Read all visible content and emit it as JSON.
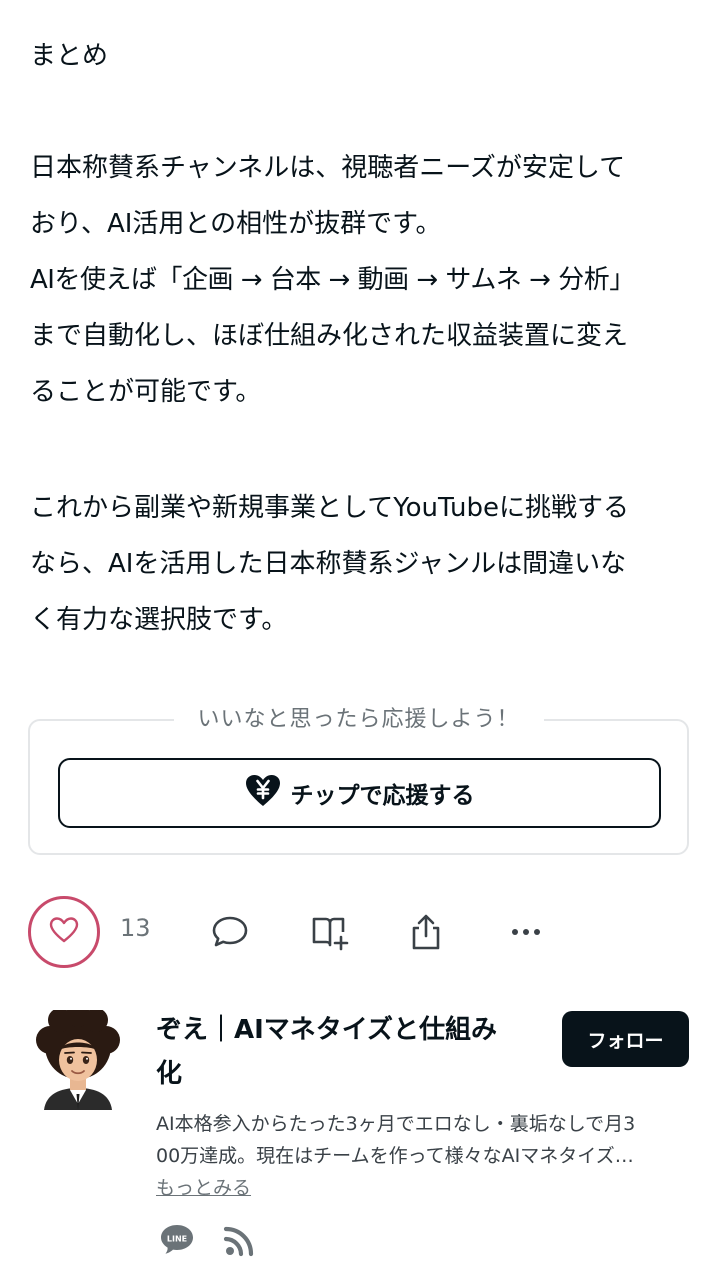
{
  "article": {
    "heading": "まとめ",
    "paragraph1_lines": [
      "日本称賛系チャンネルは、視聴者ニーズが安定して",
      "おり、AI活用との相性が抜群です。",
      "AIを使えば「企画 → 台本 → 動画 → サムネ → 分析」",
      "まで自動化し、ほぼ仕組み化された収益装置に変え",
      "ることが可能です。"
    ],
    "paragraph2_lines": [
      "これから副業や新規事業としてYouTubeに挑戦する",
      "なら、AIを活用した日本称賛系ジャンルは間違いな",
      "く有力な選択肢です。"
    ]
  },
  "support": {
    "caption": "いいなと思ったら応援しよう！",
    "tip_button_label": "チップで応援する"
  },
  "actions": {
    "like_count": "13",
    "icons": [
      "heart-icon",
      "comment-icon",
      "magazine-add-icon",
      "share-icon",
      "more-icon"
    ]
  },
  "author": {
    "name_line1": "ぞえ｜AIマネタイズと仕組み",
    "name_line2": "化",
    "follow_label": "フォロー",
    "bio_line1": "AI本格参入からたった3ヶ月でエロなし・裏垢なしで月3",
    "bio_line2": "00万達成。現在はチームを作って様々なAIマネタイズ…",
    "more_label": "もっとみる",
    "line_badge_text": "LINE"
  },
  "colors": {
    "text": "#08131a",
    "like_accent": "#c84a6b",
    "muted": "#6b7378",
    "border": "#e4e6e8"
  }
}
